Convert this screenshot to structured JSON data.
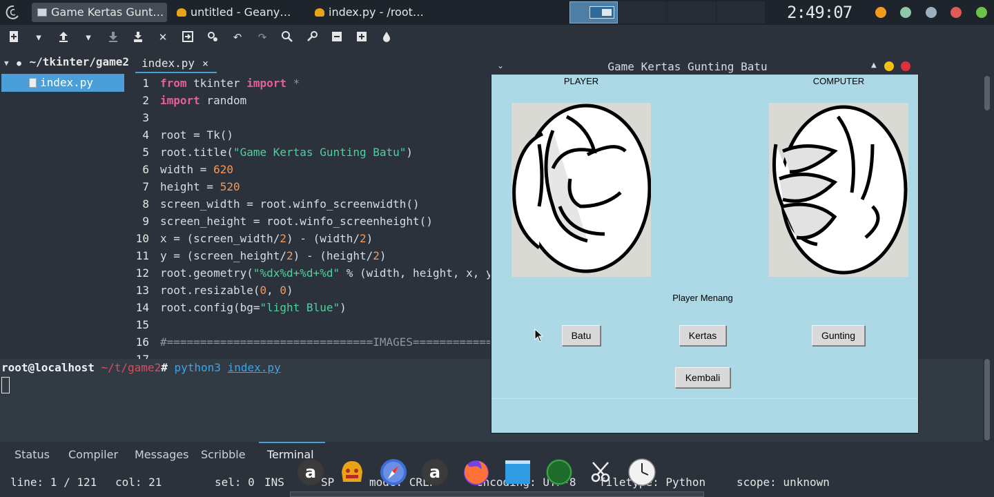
{
  "panel": {
    "tasks": [
      {
        "label": "Game Kertas Gunt…",
        "active": true
      },
      {
        "label": "untitled - Geany…",
        "active": false
      },
      {
        "label": "index.py - /root…",
        "active": false
      }
    ],
    "clock": "2:49:07"
  },
  "sidebar": {
    "root_folder": "~/tkinter/game2",
    "file": "index.py"
  },
  "editor": {
    "tab_label": "index.py",
    "tab_close": "×"
  },
  "terminal": {
    "user_host": "root@localhost",
    "path": "~/t/game2",
    "prompt_symbol": "#",
    "command": "python3",
    "argument": "index.py"
  },
  "message_tabs": [
    "Status",
    "Compiler",
    "Messages",
    "Scribble",
    "Terminal"
  ],
  "statusbar": {
    "line": "line: 1 / 121",
    "col": "col: 21",
    "sel": "sel: 0",
    "ins": "INS",
    "sp": "SP",
    "mode": "mode: CRLF",
    "encoding": "encoding: UTF-8",
    "filetype": "filetype: Python",
    "scope": "scope: unknown"
  },
  "game_window": {
    "title": "Game Kertas Gunting Batu",
    "player_label": "PLAYER",
    "computer_label": "COMPUTER",
    "result": "Player Menang",
    "buttons": {
      "batu": "Batu",
      "kertas": "Kertas",
      "gunting": "Gunting",
      "kembali": "Kembali"
    }
  },
  "colors": {
    "game_bg": "#add8e6",
    "editor_bg": "#2b323b",
    "keyword": "#e85d9d",
    "string": "#4fd0a0",
    "number": "#f29a5c",
    "accent": "#4a9fd8"
  }
}
